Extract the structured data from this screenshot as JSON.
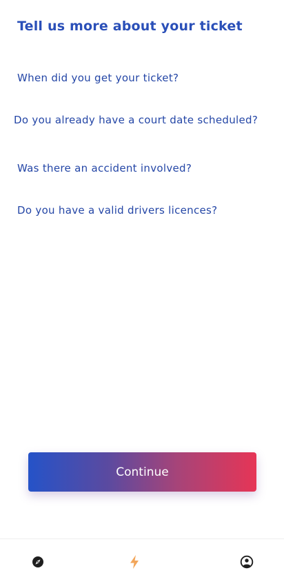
{
  "header": {
    "title": "Tell us more about your ticket"
  },
  "questions": [
    {
      "label": "When did you get your ticket?"
    },
    {
      "label": "Do you already have a court date scheduled?"
    },
    {
      "label": "Was there an accident involved?"
    },
    {
      "label": "Do you have a valid drivers licences?"
    }
  ],
  "actions": {
    "continue_label": "Continue"
  },
  "bottom_nav": {
    "items": [
      {
        "icon": "compass-icon",
        "color": "#1f1f1f"
      },
      {
        "icon": "lightning-bolt-icon",
        "color": "#f2a65a",
        "active": true
      },
      {
        "icon": "user-circle-icon",
        "color": "#1f1f1f"
      }
    ]
  },
  "colors": {
    "title": "#2a4fb8",
    "question_text": "#2446a6",
    "button_gradient_start": "#2553c8",
    "button_gradient_end": "#e63556",
    "active_nav": "#f2a65a"
  }
}
